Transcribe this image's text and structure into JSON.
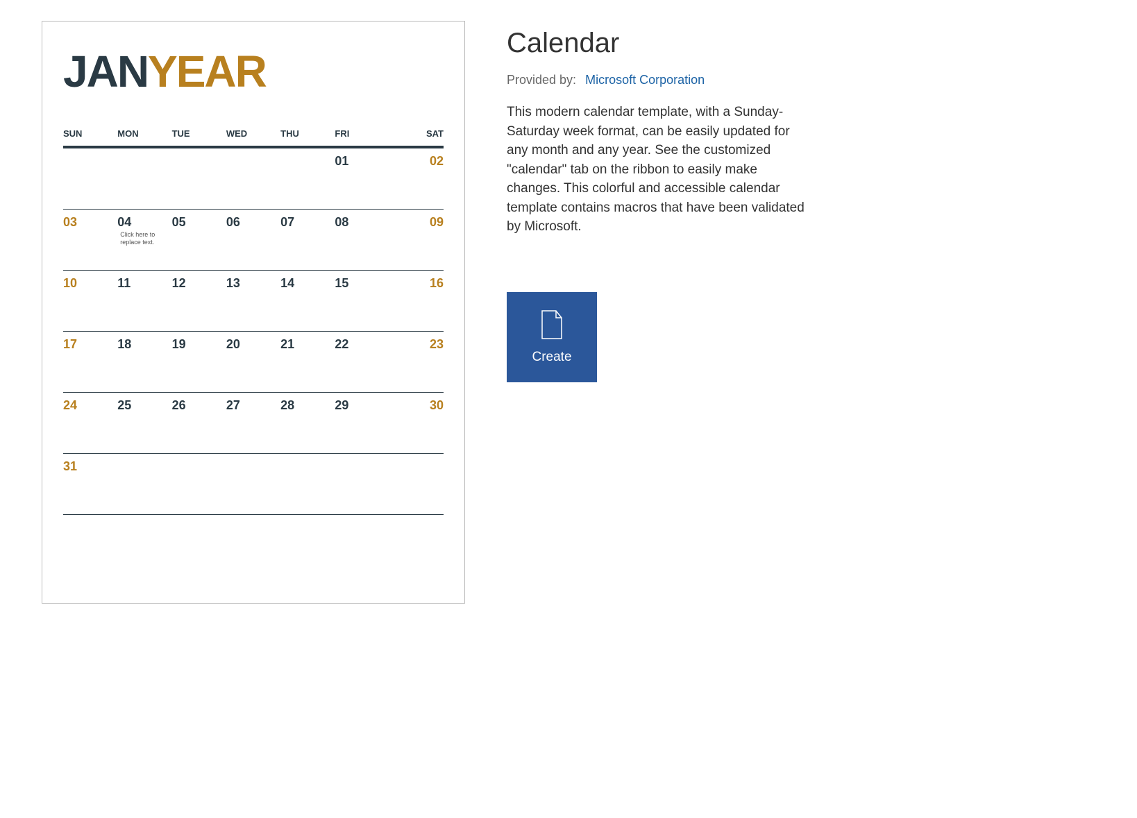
{
  "preview": {
    "month_abbr": "JAN",
    "year_label": "YEAR",
    "dow": [
      "SUN",
      "MON",
      "TUE",
      "WED",
      "THU",
      "FRI",
      "SAT"
    ],
    "weeks": [
      [
        "",
        "",
        "",
        "",
        "",
        "01",
        "02"
      ],
      [
        "03",
        "04",
        "05",
        "06",
        "07",
        "08",
        "09"
      ],
      [
        "10",
        "11",
        "12",
        "13",
        "14",
        "15",
        "16"
      ],
      [
        "17",
        "18",
        "19",
        "20",
        "21",
        "22",
        "23"
      ],
      [
        "24",
        "25",
        "26",
        "27",
        "28",
        "29",
        "30"
      ],
      [
        "31",
        "",
        "",
        "",
        "",
        "",
        ""
      ]
    ],
    "note_cell": {
      "week": 1,
      "col": 1,
      "text": "Click here to replace text."
    }
  },
  "detail": {
    "title": "Calendar",
    "provided_label": "Provided by:",
    "provided_by": "Microsoft Corporation",
    "description": "This modern calendar template, with a Sunday-Saturday week format, can be easily updated for any month and any year. See the customized \"calendar\" tab on the ribbon to easily make changes. This colorful and accessible calendar template contains macros that have been validated by Microsoft.",
    "create_label": "Create"
  }
}
